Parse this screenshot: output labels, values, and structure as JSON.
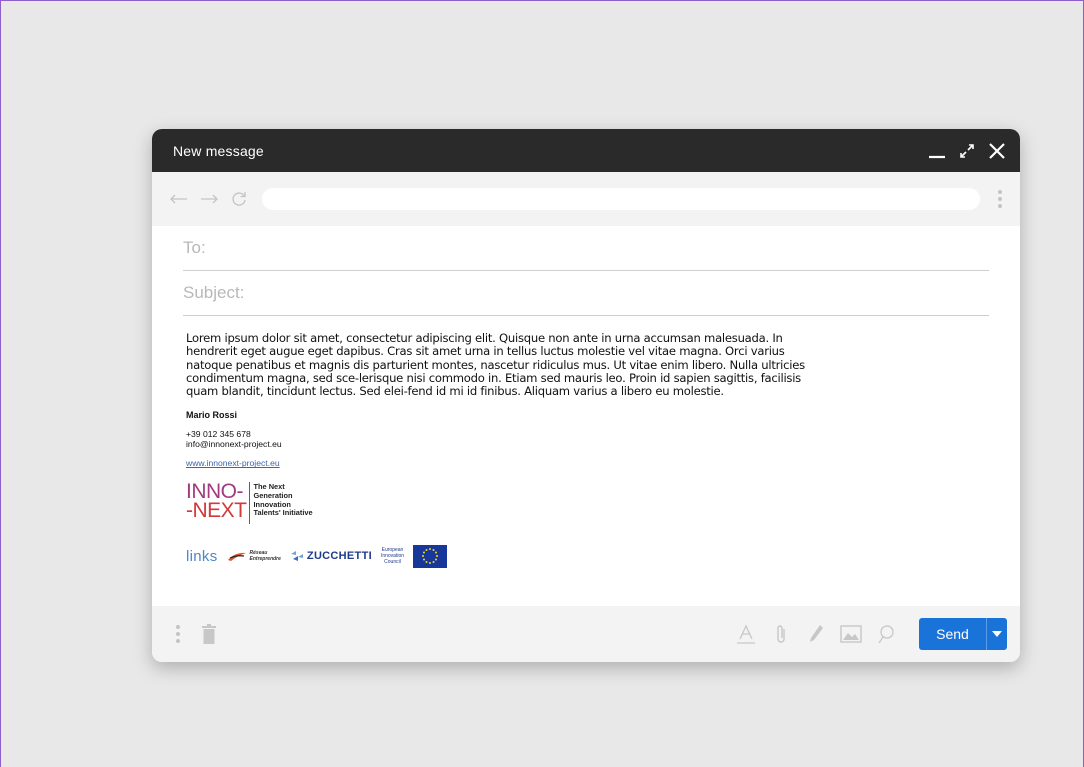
{
  "window": {
    "title": "New message"
  },
  "compose": {
    "to_label": "To:",
    "subject_label": "Subject:",
    "body": "Lorem ipsum dolor sit amet, consectetur adipiscing elit. Quisque non ante in urna accumsan malesuada. In hendrerit eget augue eget dapibus. Cras sit amet urna in tellus luctus molestie vel vitae magna. Orci varius natoque penatibus et magnis dis parturient montes, nascetur ridiculus mus. Ut vitae enim libero. Nulla ultricies condimentum magna, sed sce-lerisque nisi commodo in. Etiam sed mauris leo. Proin id sapien sagittis, facilisis quam blandit, tincidunt lectus. Sed elei-fend id mi id finibus. Aliquam varius a libero eu molestie."
  },
  "signature": {
    "name": "Mario Rossi",
    "phone": "+39 012 345 678",
    "email": "info@innonext-project.eu",
    "website": "www.innonext-project.eu",
    "logo_word_top": "INNO-",
    "logo_word_bottom": "-NEXT",
    "logo_tagline": [
      "The Next",
      "Generation",
      "Innovation",
      "Talents' Initiative"
    ],
    "partners": {
      "links": "links",
      "reseau_line1": "Réseau",
      "reseau_line2": "Entreprendre",
      "zucchetti": "ZUCCHETTI",
      "eic": [
        "European",
        "Innovation",
        "Council"
      ]
    }
  },
  "footer": {
    "send_label": "Send"
  },
  "colors": {
    "titlebar": "#2a2a2a",
    "send_button": "#1a73d9",
    "toolbar": "#f3f3f3",
    "background": "#e8e8e8",
    "inno_purple": "#a23a7f",
    "inno_red": "#d13a3a"
  },
  "icons": {
    "titlebar": [
      "minimize-icon",
      "expand-icon",
      "close-icon"
    ],
    "toolbar": [
      "back-arrow-icon",
      "forward-arrow-icon",
      "refresh-icon",
      "kebab-menu-icon"
    ],
    "footer_left": [
      "kebab-menu-icon",
      "trash-icon"
    ],
    "footer_right": [
      "text-format-icon",
      "attachment-icon",
      "pen-icon",
      "image-icon",
      "search-icon",
      "caret-down-icon"
    ]
  }
}
